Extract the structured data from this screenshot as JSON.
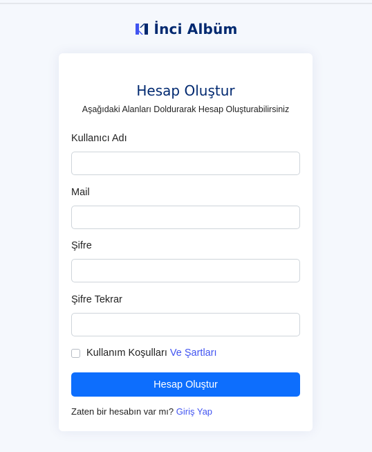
{
  "brand": {
    "logo_icon": "brand-logo-icon",
    "name": "İnci Albüm",
    "color": "#012970"
  },
  "form": {
    "title": "Hesap Oluştur",
    "subtitle": "Aşağıdaki Alanları Doldurarak Hesap Oluşturabilirsiniz",
    "fields": {
      "username": {
        "label": "Kullanıcı Adı",
        "value": ""
      },
      "mail": {
        "label": "Mail",
        "value": ""
      },
      "password": {
        "label": "Şifre",
        "value": ""
      },
      "password_repeat": {
        "label": "Şifre Tekrar",
        "value": ""
      }
    },
    "terms": {
      "checked": false,
      "text": "Kullanım Koşulları",
      "link_text": "Ve Şartları"
    },
    "submit_label": "Hesap Oluştur",
    "login_prompt": {
      "text": "Zaten bir hesabın var mı?",
      "link_text": "Giriş Yap"
    }
  },
  "colors": {
    "page_background": "#f5f8fd",
    "primary_button": "#0d6efd",
    "link": "#4154f1",
    "title": "#012970"
  }
}
